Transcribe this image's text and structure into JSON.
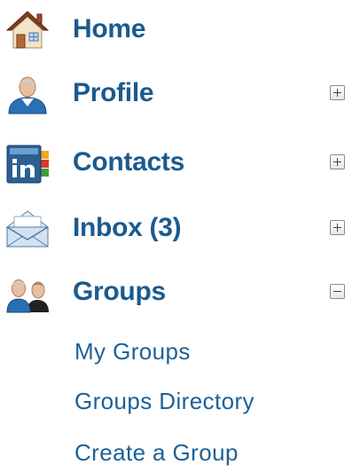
{
  "nav": {
    "home": {
      "label": "Home",
      "icon": "home-icon"
    },
    "profile": {
      "label": "Profile",
      "icon": "profile-icon",
      "toggle": "+"
    },
    "contacts": {
      "label": "Contacts",
      "icon": "contacts-icon",
      "toggle": "+"
    },
    "inbox": {
      "label": "Inbox (3)",
      "icon": "inbox-icon",
      "toggle": "+"
    },
    "groups": {
      "label": "Groups",
      "icon": "groups-icon",
      "toggle": "-",
      "expanded": true,
      "children": [
        {
          "label": "My Groups"
        },
        {
          "label": "Groups Directory"
        },
        {
          "label": "Create a Group"
        }
      ]
    }
  },
  "colors": {
    "label": "#1b5a8e",
    "sublabel": "#1d6197"
  }
}
